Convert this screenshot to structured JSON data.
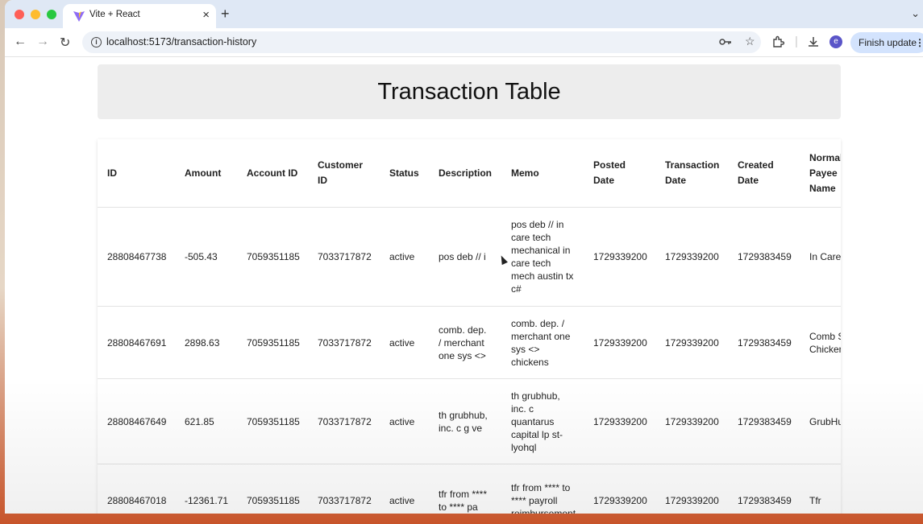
{
  "browser": {
    "tab_title": "Vite + React",
    "url": "localhost:5173/transaction-history",
    "avatar_letter": "e",
    "finish_update_label": "Finish update"
  },
  "page": {
    "title": "Transaction Table"
  },
  "table": {
    "headers": [
      "ID",
      "Amount",
      "Account ID",
      "Customer ID",
      "Status",
      "Description",
      "Memo",
      "Posted Date",
      "Transaction Date",
      "Created Date",
      "Normal Payee Name"
    ],
    "rows": [
      [
        "28808467738",
        "-505.43",
        "7059351185",
        "7033717872",
        "active",
        "pos deb // i",
        "pos deb // in care tech mechanical in care tech mech austin tx c#",
        "1729339200",
        "1729339200",
        "1729383459",
        "In Care"
      ],
      [
        "28808467691",
        "2898.63",
        "7059351185",
        "7033717872",
        "active",
        "comb. dep. / merchant one sys <>",
        "comb. dep. / merchant one sys <> chickens",
        "1729339200",
        "1729339200",
        "1729383459",
        "Comb S Chicken"
      ],
      [
        "28808467649",
        "621.85",
        "7059351185",
        "7033717872",
        "active",
        "th grubhub, inc. c g ve",
        "th grubhub, inc. c quantarus capital lp st-lyohql",
        "1729339200",
        "1729339200",
        "1729383459",
        "GrubHu"
      ],
      [
        "28808467018",
        "-12361.71",
        "7059351185",
        "7033717872",
        "active",
        "tfr from **** to **** pa",
        "tfr from **** to **** payroll reimbursement",
        "1729339200",
        "1729339200",
        "1729383459",
        "Tfr"
      ]
    ]
  },
  "colors": {
    "tabstrip": "#dfe8f5",
    "header_box": "#ededed",
    "finish_button": "#d3e3fd"
  }
}
